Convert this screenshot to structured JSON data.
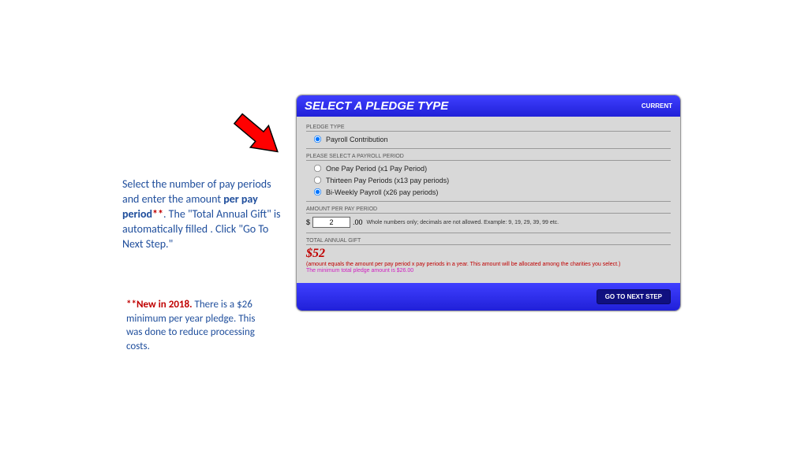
{
  "instructions": {
    "part1": "Select the number of pay periods and enter the amount ",
    "bold": "per pay period",
    "red": "**",
    "part2": ".  The \"Total Annual Gift\" is automatically filled .  Click \"Go To Next Step.\""
  },
  "footnote": {
    "red_bold": "**New in 2018.",
    "rest": "  There is a $26 minimum per year pledge.  This was done to reduce processing costs."
  },
  "form": {
    "title": "SELECT A PLEDGE TYPE",
    "current": "CURRENT",
    "pledge_type_label": "PLEDGE TYPE",
    "pledge_option": "Payroll Contribution",
    "period_label": "PLEASE SELECT A PAYROLL PERIOD",
    "periods": [
      {
        "label": "One Pay Period (x1 Pay Period)",
        "checked": false
      },
      {
        "label": "Thirteen Pay Periods (x13 pay periods)",
        "checked": false
      },
      {
        "label": "Bi-Weekly Payroll (x26 pay periods)",
        "checked": true
      }
    ],
    "amount_label": "AMOUNT PER PAY PERIOD",
    "currency": "$",
    "amount_value": "2",
    "cents": ".00",
    "amount_hint": "Whole numbers only; decimals are not allowed. Example: 9, 19, 29, 39, 99 etc.",
    "total_label": "TOTAL ANNUAL GIFT",
    "total_value": "$52",
    "total_note": "(amount equals the amount per pay period x pay periods in a year. This amount will be allocated among the charities you select.)",
    "min_note": "The minimum total pledge amount is $26.00",
    "next_button": "GO TO NEXT STEP"
  }
}
